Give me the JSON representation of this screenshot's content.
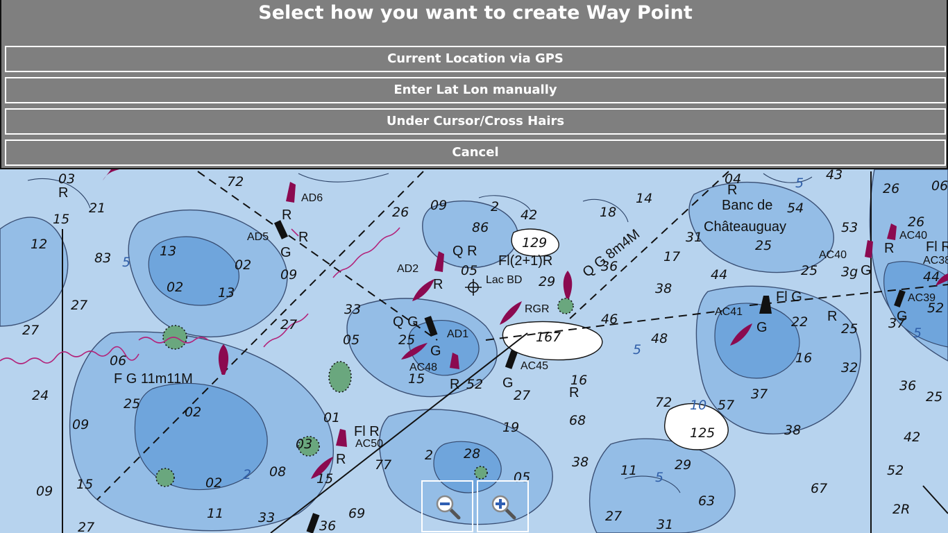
{
  "dialog": {
    "title": "Select how you want to create Way Point",
    "options": [
      {
        "label": "Current Location via GPS"
      },
      {
        "label": "Enter Lat Lon manually"
      },
      {
        "label": "Under Cursor/Cross Hairs"
      },
      {
        "label": "Cancel"
      }
    ]
  },
  "map": {
    "labels": {
      "banc": "Banc de",
      "chateauguay": "Châteauguay",
      "qr": "Q R",
      "fl21r": "Fl(2+1)R",
      "qg8m4m": "Q G 8m4M",
      "qg": "Q G",
      "flg": "Fl G",
      "fg11m11m": "F G 11m11M",
      "flr": "Fl R",
      "flr_edge": "Fl R",
      "lacbd": "Lac BD",
      "rgr": "RGR",
      "ad6": "AD6",
      "ad5": "AD5",
      "ad2": "AD2",
      "ad1": "AD1",
      "ac48": "AC48",
      "ac45": "AC45",
      "ac50": "AC50",
      "ac41": "AC41",
      "ac40": "AC40",
      "ac40b": "AC40",
      "ac39": "AC39",
      "ac38": "AC38"
    },
    "soundings": [
      "03",
      "72",
      "43",
      "26",
      "21",
      "15",
      "26",
      "09",
      "2",
      "42",
      "04",
      "54",
      "14",
      "18",
      "53",
      "26",
      "06",
      "12",
      "83",
      "13",
      "86",
      "129",
      "31",
      "25",
      "02",
      "44",
      "05",
      "17",
      "25",
      "3g",
      "44",
      "52",
      "27",
      "02",
      "13",
      "09",
      "33",
      "29",
      "36",
      "38",
      "22",
      "25",
      "37",
      "24",
      "25",
      "06",
      "27",
      "05",
      "25",
      "27",
      "167",
      "46",
      "48",
      "16",
      "32",
      "36",
      "25",
      "09",
      "02",
      "15",
      "52",
      "27",
      "16",
      "68",
      "72",
      "57",
      "37",
      "38",
      "01",
      "19",
      "42",
      "125",
      "29",
      "11",
      "03",
      "2",
      "28",
      "38",
      "52",
      "02",
      "08",
      "15",
      "77",
      "05",
      "63",
      "67",
      "09",
      "15",
      "11",
      "33",
      "36",
      "69",
      "27",
      "31",
      "2R",
      "27",
      "10",
      "5",
      "5",
      "5",
      "5",
      "2",
      "5"
    ],
    "marks": [
      "R",
      "G",
      "R",
      "R",
      "G",
      "R",
      "G",
      "G",
      "R",
      "R",
      "R",
      "G",
      "R",
      "R",
      "G",
      "R"
    ]
  },
  "zoom": {
    "out_icon": "zoom-out-icon",
    "in_icon": "zoom-in-icon"
  },
  "colors": {
    "dialog_bg": "#7f7f7f",
    "deep_water": "#b7d3ee",
    "mid_water": "#94bde6",
    "shallow_water": "#6fa5dc",
    "land": "#ffffff",
    "buoy": "#8b0a50",
    "vegetation": "#6aa77e"
  }
}
